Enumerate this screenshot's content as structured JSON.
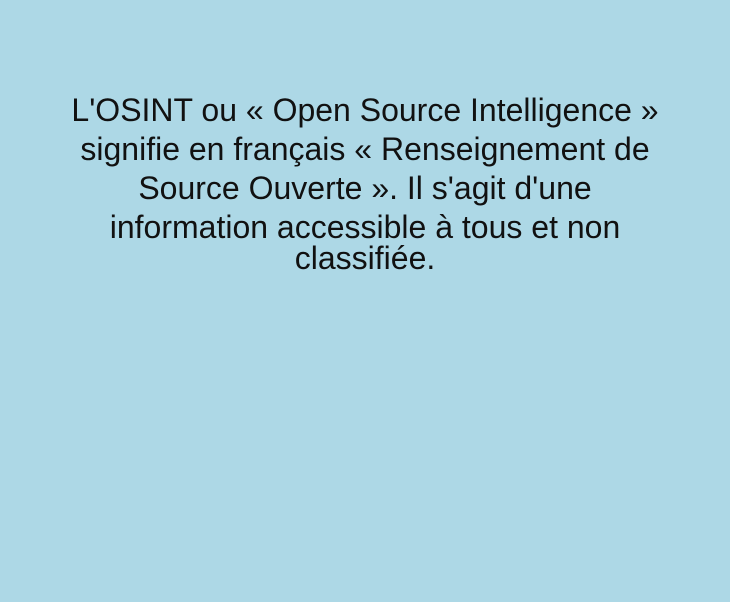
{
  "background_color": "#add8e6",
  "text_color": "#111111",
  "paragraph": {
    "lines": [
      "L'OSINT ou « Open Source Intelligence »",
      "signifie en français « Renseignement de",
      "Source Ouverte ». Il s'agit d'une",
      "information accessible à tous et non",
      "classifiée."
    ]
  }
}
